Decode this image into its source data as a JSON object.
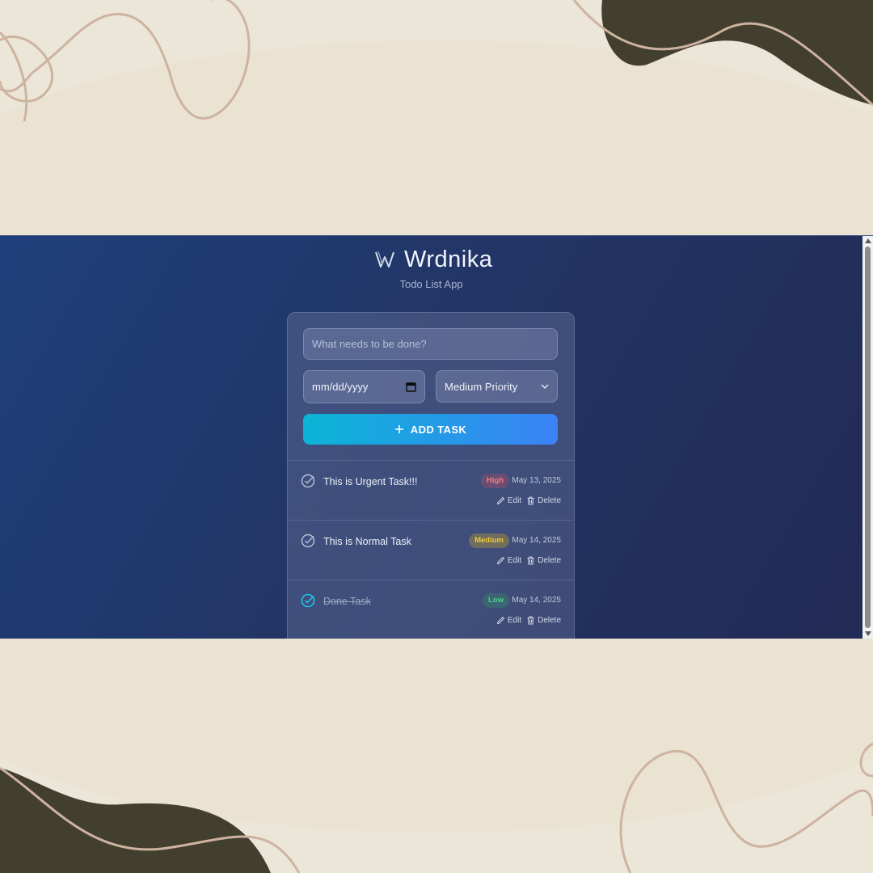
{
  "app": {
    "title": "Wrdnika",
    "subtitle": "Todo List App"
  },
  "form": {
    "task_placeholder": "What needs to be done?",
    "date_placeholder": "mm/dd/yyyy",
    "priority_selected": "Medium Priority",
    "add_button_label": "ADD TASK"
  },
  "tasks": [
    {
      "title": "This is Urgent Task!!!",
      "priority": "High",
      "date": "May 13, 2025",
      "completed": false,
      "edit_label": "Edit",
      "delete_label": "Delete"
    },
    {
      "title": "This is Normal Task",
      "priority": "Medium",
      "date": "May 14, 2025",
      "completed": false,
      "edit_label": "Edit",
      "delete_label": "Delete"
    },
    {
      "title": "Done Task",
      "priority": "Low",
      "date": "May 14, 2025",
      "completed": true,
      "edit_label": "Edit",
      "delete_label": "Delete"
    }
  ],
  "colors": {
    "accent_gradient_start": "#0bb5d6",
    "accent_gradient_end": "#3b82f6",
    "high": "#f47a83",
    "medium": "#f1cb3a",
    "low": "#50d089",
    "completed_check": "#22c3e6"
  }
}
